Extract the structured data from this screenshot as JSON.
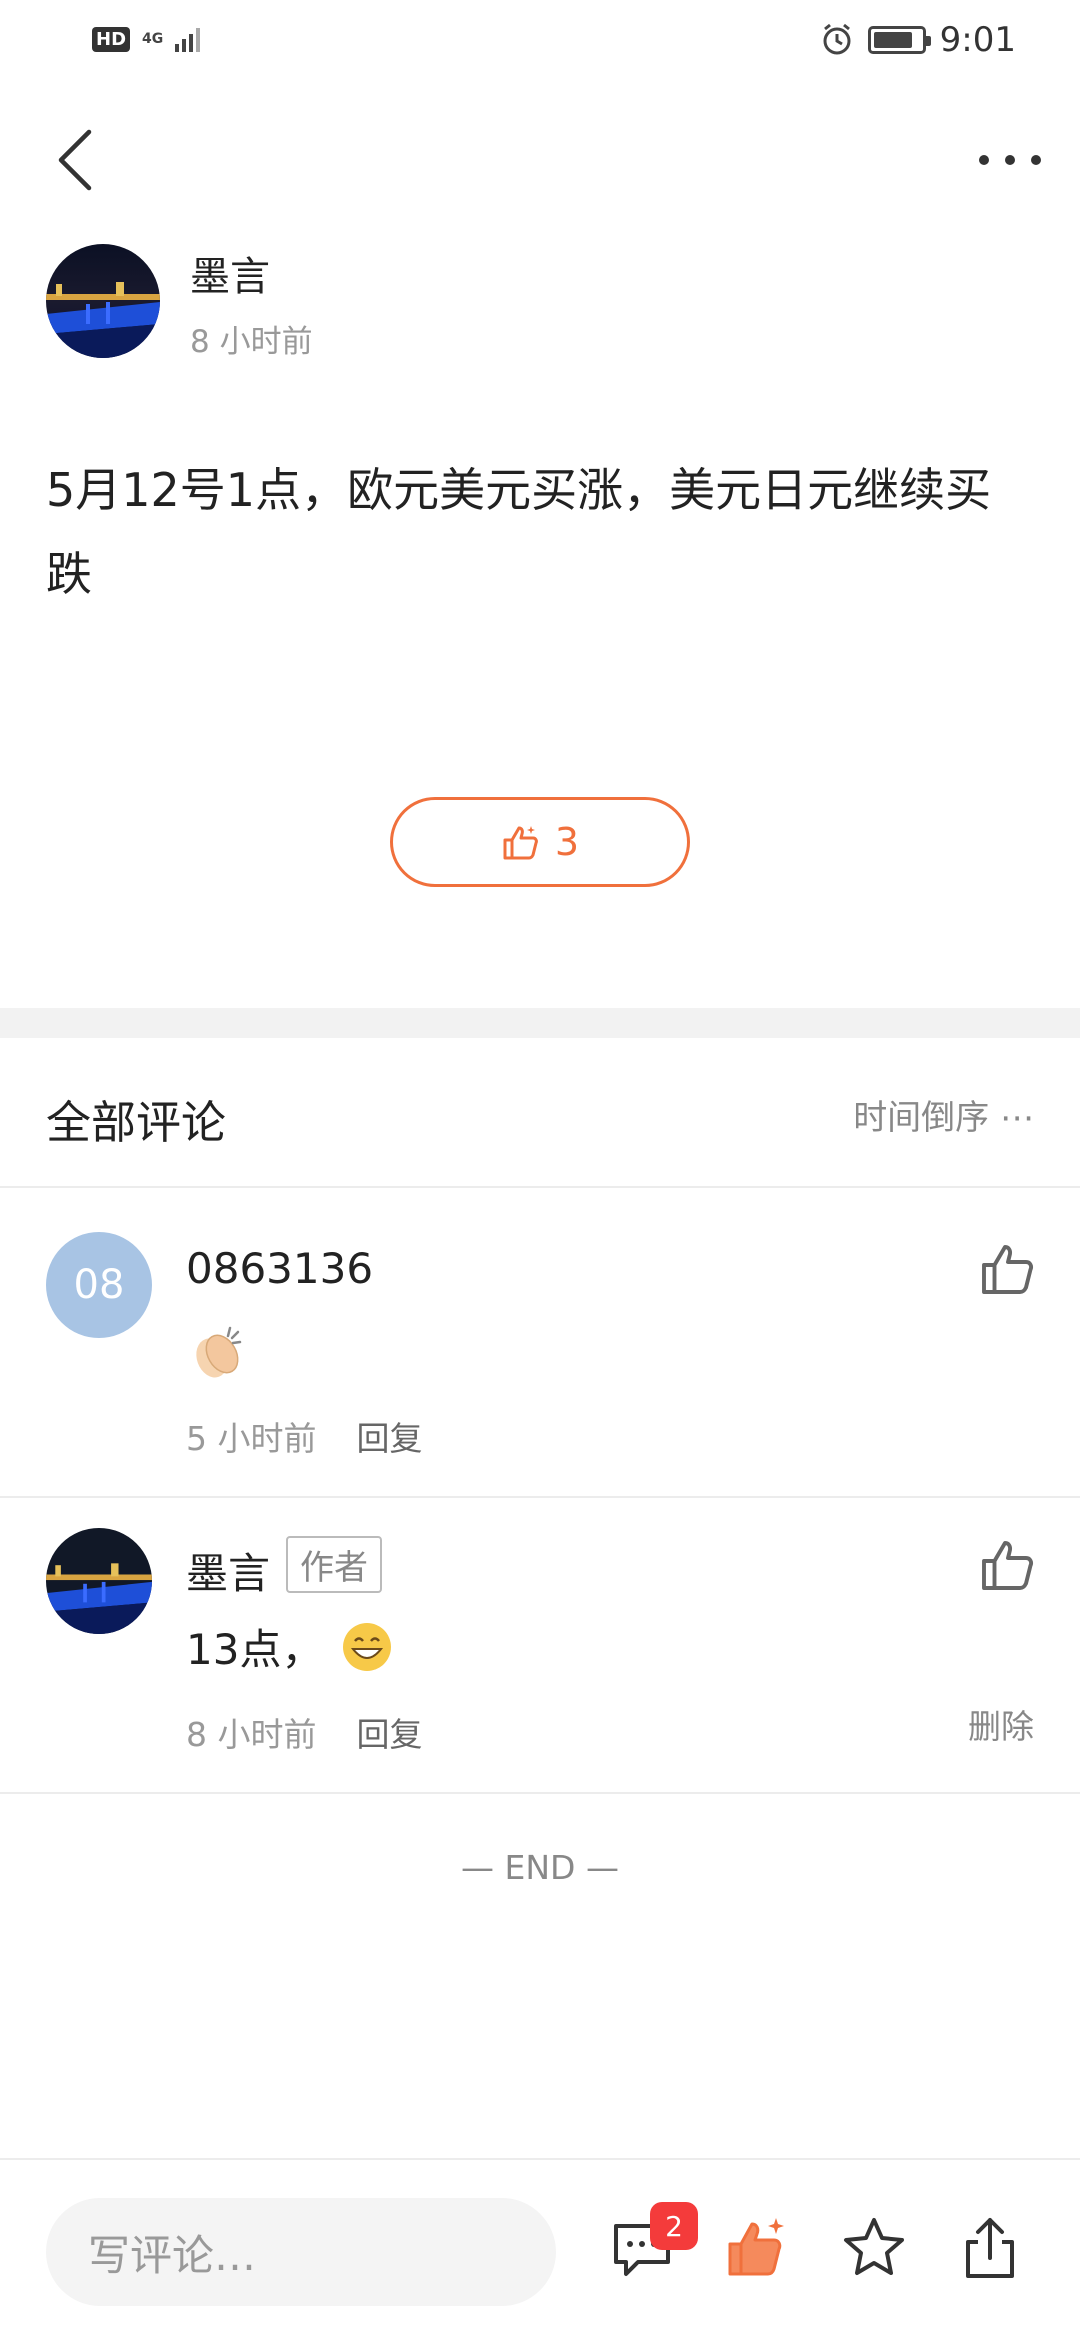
{
  "status_bar": {
    "hd": "HD",
    "network": "4G",
    "time": "9:01",
    "battery_level": 0.85
  },
  "nav": {
    "back_icon": "chevron-left-icon",
    "more_icon": "more-dots-icon"
  },
  "post": {
    "author": "墨言",
    "time": "8 小时前",
    "body": "5月12号1点，欧元美元买涨，美元日元继续买跌",
    "like_count": "3"
  },
  "comments_section": {
    "title": "全部评论",
    "sort_label": "时间倒序 ⋯",
    "comments": [
      {
        "avatar_text": "08",
        "avatar_color": "#a8c4e4",
        "name": "0863136",
        "content_emoji": "clapping-hands",
        "time": "5 小时前",
        "reply_label": "回复"
      },
      {
        "name": "墨言",
        "tag": "作者",
        "text": "13点，",
        "content_emoji": "grinning-face",
        "time": "8 小时前",
        "reply_label": "回复",
        "delete_label": "删除"
      }
    ],
    "end_text": "— END —"
  },
  "bottom_bar": {
    "input_placeholder": "写评论…",
    "comment_badge": "2",
    "accent_color": "#f0703c"
  }
}
